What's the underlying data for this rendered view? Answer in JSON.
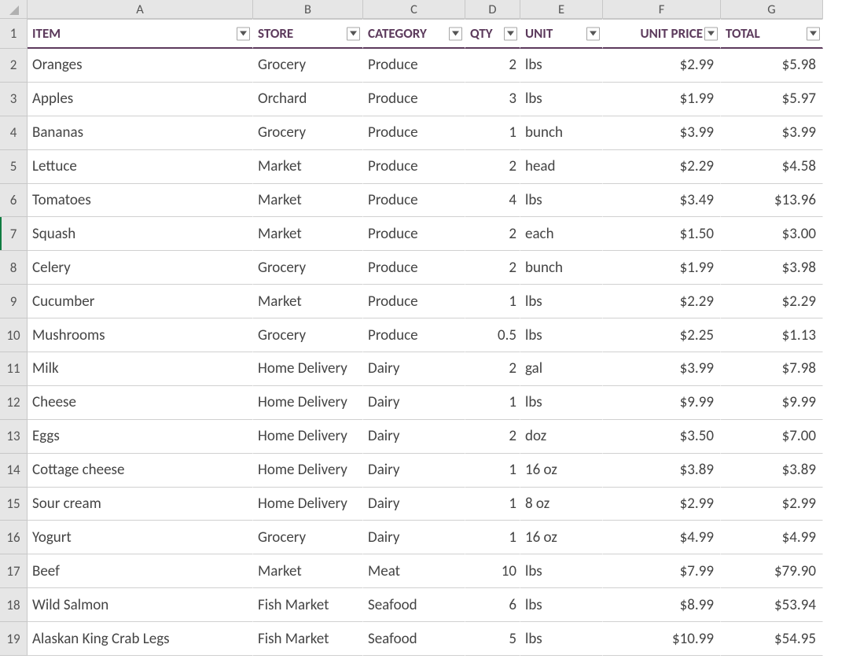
{
  "columns": [
    "A",
    "B",
    "C",
    "D",
    "E",
    "F",
    "G"
  ],
  "headers": {
    "item": "ITEM",
    "store": "STORE",
    "category": "CATEGORY",
    "qty": "QTY",
    "unit": "UNIT",
    "unit_price": "UNIT PRICE",
    "total": "TOTAL"
  },
  "rows": [
    {
      "n": "2",
      "item": "Oranges",
      "store": "Grocery",
      "category": "Produce",
      "qty": "2",
      "unit": "lbs",
      "unit_price": "$2.99",
      "total": "$5.98"
    },
    {
      "n": "3",
      "item": "Apples",
      "store": "Orchard",
      "category": "Produce",
      "qty": "3",
      "unit": "lbs",
      "unit_price": "$1.99",
      "total": "$5.97"
    },
    {
      "n": "4",
      "item": "Bananas",
      "store": "Grocery",
      "category": "Produce",
      "qty": "1",
      "unit": "bunch",
      "unit_price": "$3.99",
      "total": "$3.99"
    },
    {
      "n": "5",
      "item": "Lettuce",
      "store": "Market",
      "category": "Produce",
      "qty": "2",
      "unit": "head",
      "unit_price": "$2.29",
      "total": "$4.58"
    },
    {
      "n": "6",
      "item": "Tomatoes",
      "store": "Market",
      "category": "Produce",
      "qty": "4",
      "unit": "lbs",
      "unit_price": "$3.49",
      "total": "$13.96"
    },
    {
      "n": "7",
      "item": "Squash",
      "store": "Market",
      "category": "Produce",
      "qty": "2",
      "unit": "each",
      "unit_price": "$1.50",
      "total": "$3.00"
    },
    {
      "n": "8",
      "item": "Celery",
      "store": "Grocery",
      "category": "Produce",
      "qty": "2",
      "unit": "bunch",
      "unit_price": "$1.99",
      "total": "$3.98"
    },
    {
      "n": "9",
      "item": "Cucumber",
      "store": "Market",
      "category": "Produce",
      "qty": "1",
      "unit": "lbs",
      "unit_price": "$2.29",
      "total": "$2.29"
    },
    {
      "n": "10",
      "item": "Mushrooms",
      "store": "Grocery",
      "category": "Produce",
      "qty": "0.5",
      "unit": "lbs",
      "unit_price": "$2.25",
      "total": "$1.13"
    },
    {
      "n": "11",
      "item": "Milk",
      "store": "Home Delivery",
      "category": "Dairy",
      "qty": "2",
      "unit": "gal",
      "unit_price": "$3.99",
      "total": "$7.98"
    },
    {
      "n": "12",
      "item": "Cheese",
      "store": "Home Delivery",
      "category": "Dairy",
      "qty": "1",
      "unit": "lbs",
      "unit_price": "$9.99",
      "total": "$9.99"
    },
    {
      "n": "13",
      "item": "Eggs",
      "store": "Home Delivery",
      "category": "Dairy",
      "qty": "2",
      "unit": "doz",
      "unit_price": "$3.50",
      "total": "$7.00"
    },
    {
      "n": "14",
      "item": "Cottage cheese",
      "store": "Home Delivery",
      "category": "Dairy",
      "qty": "1",
      "unit": "16 oz",
      "unit_price": "$3.89",
      "total": "$3.89"
    },
    {
      "n": "15",
      "item": "Sour cream",
      "store": "Home Delivery",
      "category": "Dairy",
      "qty": "1",
      "unit": "8 oz",
      "unit_price": "$2.99",
      "total": "$2.99"
    },
    {
      "n": "16",
      "item": "Yogurt",
      "store": "Grocery",
      "category": "Dairy",
      "qty": "1",
      "unit": "16 oz",
      "unit_price": "$4.99",
      "total": "$4.99"
    },
    {
      "n": "17",
      "item": "Beef",
      "store": "Market",
      "category": "Meat",
      "qty": "10",
      "unit": "lbs",
      "unit_price": "$7.99",
      "total": "$79.90"
    },
    {
      "n": "18",
      "item": "Wild Salmon",
      "store": "Fish Market",
      "category": "Seafood",
      "qty": "6",
      "unit": "lbs",
      "unit_price": "$8.99",
      "total": "$53.94"
    },
    {
      "n": "19",
      "item": "Alaskan King Crab Legs",
      "store": "Fish Market",
      "category": "Seafood",
      "qty": "5",
      "unit": "lbs",
      "unit_price": "$10.99",
      "total": "$54.95"
    }
  ],
  "selected_row": "7"
}
